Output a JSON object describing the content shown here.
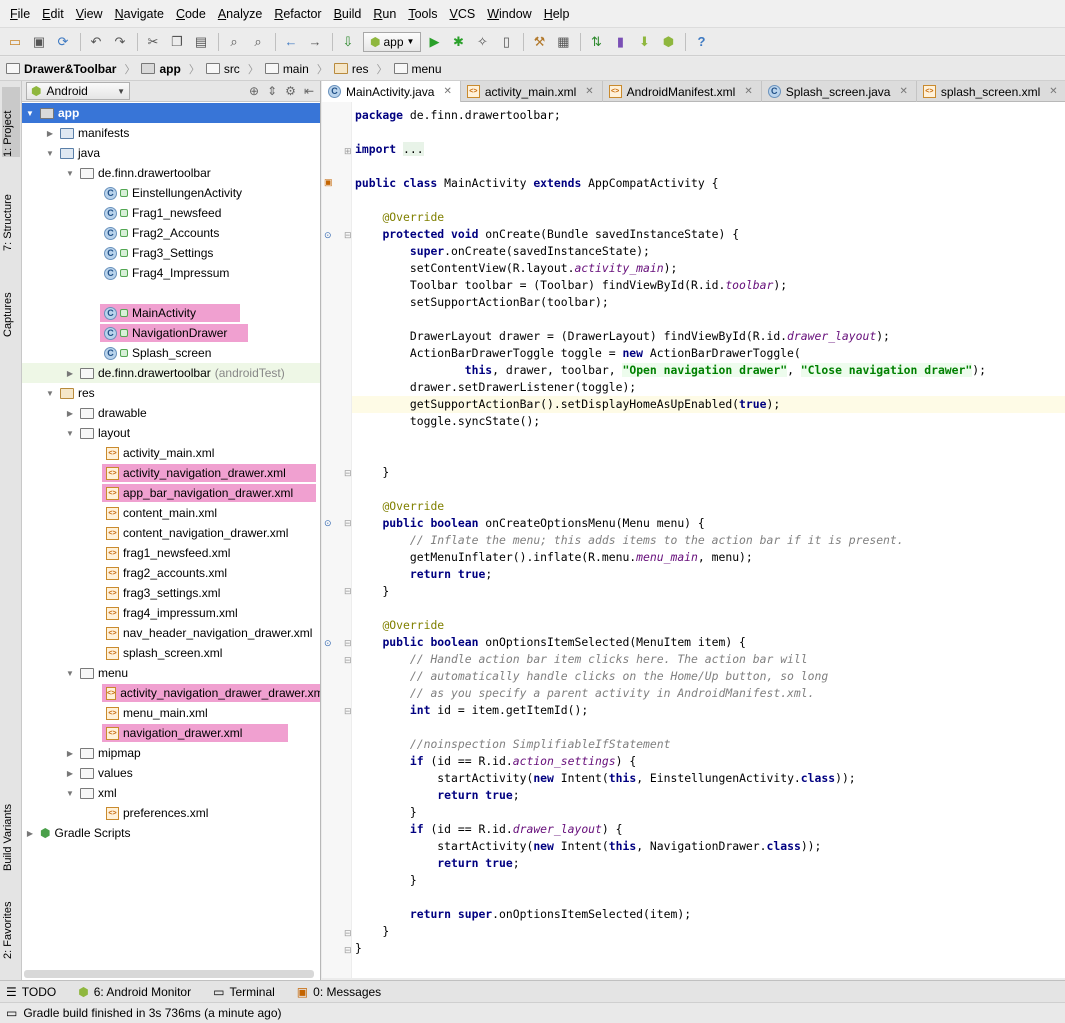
{
  "menu": [
    "File",
    "Edit",
    "View",
    "Navigate",
    "Code",
    "Analyze",
    "Refactor",
    "Build",
    "Run",
    "Tools",
    "VCS",
    "Window",
    "Help"
  ],
  "toolbar": {
    "run_config": "app"
  },
  "breadcrumb": [
    "Drawer&Toolbar",
    "app",
    "src",
    "main",
    "res",
    "menu"
  ],
  "side_tabs": {
    "project": "1: Project",
    "structure": "7: Structure",
    "captures": "Captures",
    "build_variants": "Build Variants",
    "favorites": "2: Favorites"
  },
  "project_panel": {
    "view_mode": "Android"
  },
  "tree": {
    "app": "app",
    "manifests": "manifests",
    "java": "java",
    "pkg_main": "de.finn.drawertoolbar",
    "classes": [
      "EinstellungenActivity",
      "Frag1_newsfeed",
      "Frag2_Accounts",
      "Frag3_Settings",
      "Frag4_Impressum",
      "MainActivity",
      "NavigationDrawer",
      "Splash_screen"
    ],
    "pkg_test": "de.finn.drawertoolbar",
    "pkg_test_suffix": "(androidTest)",
    "res": "res",
    "drawable": "drawable",
    "layout": "layout",
    "layout_files": [
      "activity_main.xml",
      "activity_navigation_drawer.xml",
      "app_bar_navigation_drawer.xml",
      "content_main.xml",
      "content_navigation_drawer.xml",
      "frag1_newsfeed.xml",
      "frag2_accounts.xml",
      "frag3_settings.xml",
      "frag4_impressum.xml",
      "nav_header_navigation_drawer.xml",
      "splash_screen.xml"
    ],
    "menu": "menu",
    "menu_files": [
      "activity_navigation_drawer_drawer.xml",
      "menu_main.xml",
      "navigation_drawer.xml"
    ],
    "mipmap": "mipmap",
    "values": "values",
    "xml": "xml",
    "xml_files": [
      "preferences.xml"
    ],
    "gradle": "Gradle Scripts"
  },
  "editor_tabs": [
    "MainActivity.java",
    "activity_main.xml",
    "AndroidManifest.xml",
    "Splash_screen.java",
    "splash_screen.xml"
  ],
  "bottom_tools": [
    "TODO",
    "6: Android Monitor",
    "Terminal",
    "0: Messages"
  ],
  "status": "Gradle build finished in 3s 736ms (a minute ago)",
  "colors": {
    "highlight": "#f0a0d0",
    "selection": "#3875d7",
    "keyword": "#000080",
    "string": "#008000",
    "annotation": "#808000",
    "comment": "#808080"
  }
}
